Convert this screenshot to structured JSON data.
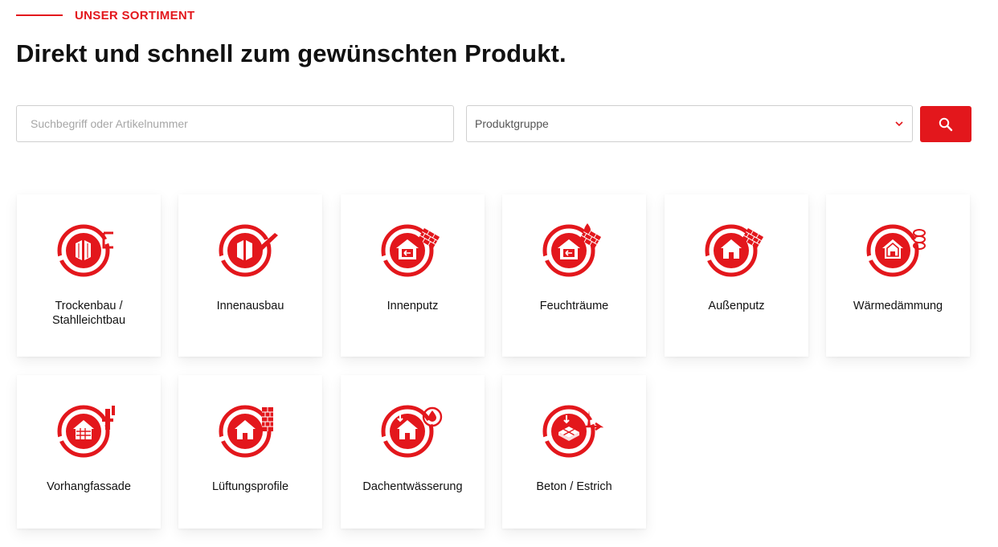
{
  "header": {
    "eyebrow": "UNSER SORTIMENT",
    "title": "Direkt und schnell zum gewünschten Produkt."
  },
  "search": {
    "placeholder": "Suchbegriff oder Artikelnummer",
    "value": "",
    "group_value": "Produktgruppe",
    "button_icon": "search-icon"
  },
  "colors": {
    "accent": "#e3171c",
    "border": "#cfcfcf"
  },
  "categories": [
    {
      "label": "Trockenbau / Stahlleichtbau",
      "icon": "drywall-icon"
    },
    {
      "label": "Innenausbau",
      "icon": "interior-construction-icon"
    },
    {
      "label": "Innenputz",
      "icon": "interior-plaster-icon"
    },
    {
      "label": "Feuchträume",
      "icon": "wet-rooms-icon"
    },
    {
      "label": "Außenputz",
      "icon": "exterior-plaster-icon"
    },
    {
      "label": "Wärmedämmung",
      "icon": "thermal-insulation-icon"
    },
    {
      "label": "Vorhangfassade",
      "icon": "curtain-facade-icon"
    },
    {
      "label": "Lüftungsprofile",
      "icon": "ventilation-profiles-icon"
    },
    {
      "label": "Dachentwässerung",
      "icon": "roof-drainage-icon"
    },
    {
      "label": "Beton / Estrich",
      "icon": "concrete-screed-icon"
    }
  ]
}
